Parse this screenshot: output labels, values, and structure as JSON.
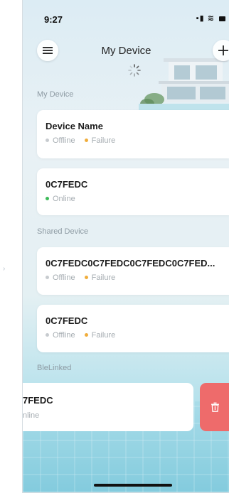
{
  "status_bar": {
    "time": "9:27"
  },
  "header": {
    "title": "My Device"
  },
  "sections": {
    "my_device": "My Device",
    "shared_device": "Shared Device",
    "ble_linked": "BleLinked"
  },
  "my_devices": [
    {
      "name": "Device Name",
      "status": "Offline",
      "failure": "Failure"
    },
    {
      "name": "0C7FEDC",
      "status": "Online"
    }
  ],
  "shared_devices": [
    {
      "name": "0C7FEDC0C7FEDC0C7FEDC0C7FED...",
      "status": "Offline",
      "failure": "Failure"
    },
    {
      "name": "0C7FEDC",
      "status": "Offline",
      "failure": "Failure"
    }
  ],
  "ble_linked_devices": [
    {
      "name": "7FEDC",
      "status": "nline"
    }
  ],
  "colors": {
    "offline_dot": "#c7cbcf",
    "failure_dot": "#f0ad3c",
    "online_dot": "#3dbb5a",
    "delete_bg": "#ee6b6b"
  },
  "icons": {
    "menu": "menu-icon",
    "add": "plus-icon",
    "loading": "spinner-icon",
    "delete": "trash-icon"
  }
}
